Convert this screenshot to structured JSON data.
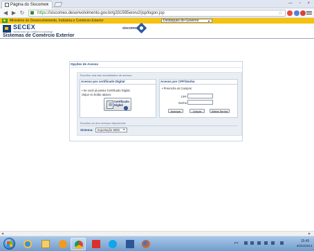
{
  "browser": {
    "tab_title": "Página do Siscomex",
    "tab_close": "×",
    "window_controls": "— ▫ ×",
    "url_scheme": "https",
    "url_rest": "://siscomex.desenvolvimento.gov.br/g331595enxv2/jsp/logon.jsp",
    "back_icon": "◀",
    "forward_icon": "▶",
    "reload_icon": "↻",
    "star_icon": "☆"
  },
  "gov_bar": {
    "ministry": "Ministério do Desenvolvimento, Indústria e Comércio Exterior",
    "dropdown_selected": "Destaques do Governo",
    "dropdown_arrow": "▼"
  },
  "header": {
    "logo": "SECEX",
    "logo_subtitle": "SECRETARIA DE COMÉRCIO EXTERIOR",
    "siscomex_logo": "siscomex",
    "page_title": "Sistemas de Comércio Exterior"
  },
  "panel": {
    "title": "Opções de Acesso",
    "choose_mode": "Escolha uma das modalidades de acesso:",
    "certificate": {
      "heading": "Acesso por certificado Digital",
      "text": "• Se você já possui Certificado Digital, clique no botão abaixo:",
      "button_label": "Certificado Digital"
    },
    "cpf": {
      "heading": "Acesso por CPF/Senha",
      "instruction": "• Preencha os Campos:",
      "cpf_label": "CPF",
      "password_label": "Senha",
      "cpf_value": "",
      "password_value": "",
      "btn_advance": "Avançar",
      "btn_clear": "Limpar",
      "btn_change_password": "Altera Senha"
    },
    "choose_service": "Escolha um dos serviços disponíveis:",
    "system_label": "Sistema:",
    "system_selected": "Exportação WEB",
    "system_arrow": "▼"
  },
  "taskbar": {
    "lang": "PT",
    "time": "15:45",
    "date": "30/04/2014"
  }
}
